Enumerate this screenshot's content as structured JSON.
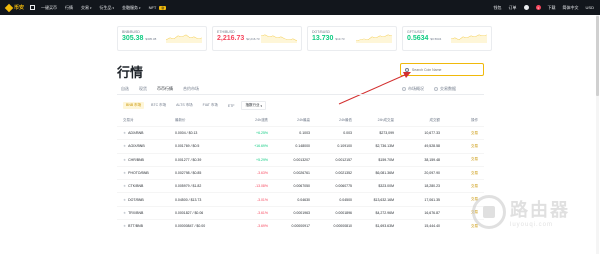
{
  "nav": {
    "brand": "币安",
    "items": [
      "一键买币",
      "行情",
      "交易",
      "衍生品",
      "金融服务",
      "NFT"
    ],
    "nft_badge": "新",
    "right": [
      "钱包",
      "订单",
      "下载",
      "简体中文",
      "USD"
    ],
    "notifications": "1"
  },
  "cards": [
    {
      "symbol": "BNB/BUSD",
      "price": "305.38",
      "sub": "$305.38",
      "trend": "up"
    },
    {
      "symbol": "ETH/BUSD",
      "price": "2,216.73",
      "sub": "$2,216.73",
      "trend": "down"
    },
    {
      "symbol": "DOT/BUSD",
      "price": "13.730",
      "sub": "$13.73",
      "trend": "up"
    },
    {
      "symbol": "GFT/USDT",
      "price": "0.5634",
      "sub": "$0.5634",
      "trend": "up"
    }
  ],
  "page_title": "行情",
  "search": {
    "placeholder": "Search Coin Name"
  },
  "tabs": [
    "自选",
    "现货",
    "币币行情",
    "合约市场"
  ],
  "right_links": [
    "市场概况",
    "交易数据"
  ],
  "subtabs": [
    "BNB 市场",
    "BTC 市场",
    "ALTS 市场",
    "FIAT 市场",
    "ETF",
    "指数行业"
  ],
  "table": {
    "headers": [
      "交易对",
      "最新价",
      "24h涨跌",
      "24h最高",
      "24h最低",
      "24h成交量",
      "成交额",
      "操作"
    ],
    "rows": [
      {
        "pair": "ADX/BNB",
        "price": "0.0004 / $0.13",
        "change": "+6.25%",
        "high": "0.1003",
        "low": "0.003",
        "vol": "$273,099",
        "turnover": "10,677.33",
        "action": "交易"
      },
      {
        "pair": "AGIX/BNB",
        "price": "0.001769 / $0.5",
        "change": "+16.69%",
        "high": "0.148000",
        "low": "0.109100",
        "vol": "$2,736.13M",
        "turnover": "49,528.58",
        "action": "交易"
      },
      {
        "pair": "CHR/BNB",
        "price": "0.001277 / $0.39",
        "change": "+5.29%",
        "high": "0.0013207",
        "low": "0.0012157",
        "vol": "$159.70M",
        "turnover": "38,159.48",
        "action": "交易"
      },
      {
        "pair": "PHOTO/BNB",
        "price": "0.002798 / $0.85",
        "change": "-3.63%",
        "high": "0.0026761",
        "low": "0.0021352",
        "vol": "$6,081.36M",
        "turnover": "20,097.90",
        "action": "交易"
      },
      {
        "pair": "CTK/BNB",
        "price": "0.005979 / $1.82",
        "change": "-13.08%",
        "high": "0.0067050",
        "low": "0.0060775",
        "vol": "$323.00M",
        "turnover": "18,280.23",
        "action": "交易"
      },
      {
        "pair": "DOT/BNB",
        "price": "0.04500 / $13.73",
        "change": "-3.01%",
        "high": "0.04630",
        "low": "0.04500",
        "vol": "$13,632.16M",
        "turnover": "17,061.35",
        "action": "交易"
      },
      {
        "pair": "TRX/BNB",
        "price": "0.0001827 / $0.06",
        "change": "-3.61%",
        "high": "0.0001963",
        "low": "0.0001896",
        "vol": "$4,272.96M",
        "turnover": "16,676.87",
        "action": "交易"
      },
      {
        "pair": "BTT/BNB",
        "price": "0.00000847 / $0.00",
        "change": "-3.69%",
        "high": "0.00000917",
        "low": "0.00000810",
        "vol": "$1,693.63M",
        "turnover": "15,444.40",
        "action": "交易"
      }
    ]
  },
  "watermark": {
    "cn": "路由器",
    "en": "luyouqi.com"
  },
  "colors": {
    "brand": "#f0b90b",
    "up": "#0ecb81",
    "down": "#f6465d",
    "nav_bg": "#12161c",
    "annotation_arrow": "#d32f2f"
  }
}
